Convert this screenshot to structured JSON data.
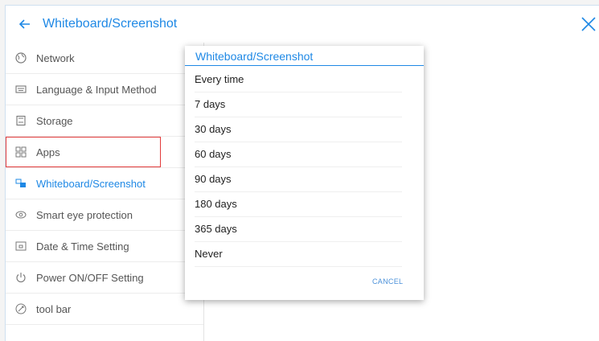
{
  "header": {
    "title": "Whiteboard/Screenshot"
  },
  "sidebar": {
    "items": [
      {
        "label": "Network",
        "icon": "globe-icon"
      },
      {
        "label": "Language & Input Method",
        "icon": "keyboard-icon"
      },
      {
        "label": "Storage",
        "icon": "storage-icon"
      },
      {
        "label": "Apps",
        "icon": "apps-icon"
      },
      {
        "label": "Whiteboard/Screenshot",
        "icon": "whiteboard-icon",
        "active": true
      },
      {
        "label": "Smart eye protection",
        "icon": "eye-icon"
      },
      {
        "label": "Date & Time Setting",
        "icon": "calendar-icon"
      },
      {
        "label": "Power ON/OFF Setting",
        "icon": "power-icon"
      },
      {
        "label": "tool bar",
        "icon": "toolbar-icon"
      }
    ]
  },
  "dialog": {
    "title": "Whiteboard/Screenshot",
    "options": [
      "Every time",
      "7 days",
      "30 days",
      "60 days",
      "90 days",
      "180 days",
      "365 days",
      "Never"
    ],
    "cancel_label": "CANCEL"
  },
  "colors": {
    "accent": "#1e88e5",
    "highlight_border": "#e23b3b"
  }
}
